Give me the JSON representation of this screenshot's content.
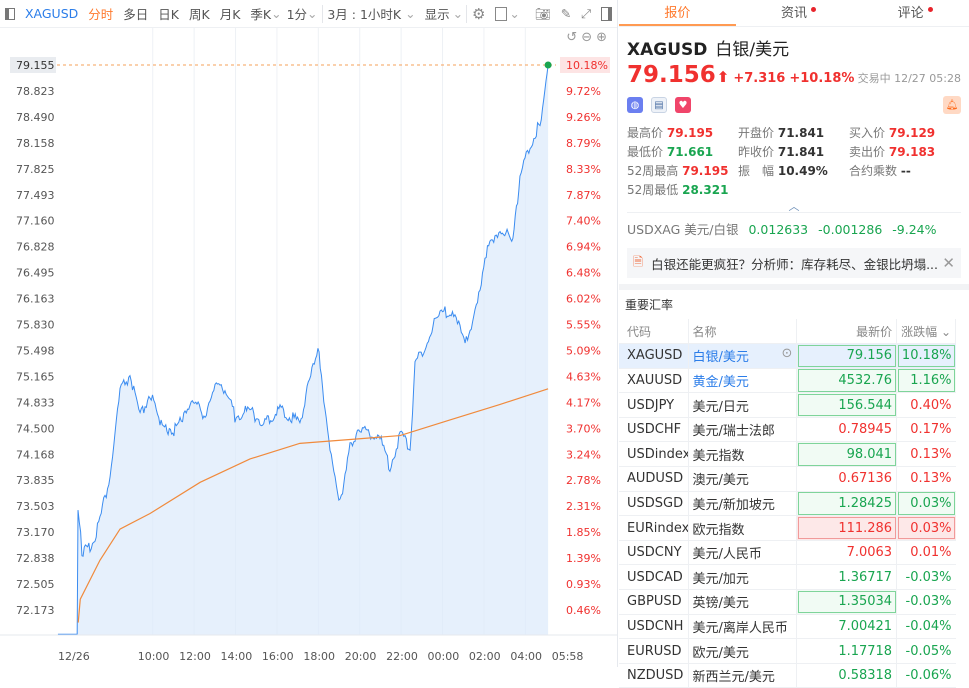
{
  "toolbar": {
    "symbol": "XAGUSD",
    "periods": [
      "分时",
      "多日",
      "日K",
      "周K",
      "月K",
      "季K"
    ],
    "interval": "1分",
    "range": "3月 : 1小时K",
    "display": "显示"
  },
  "chart_data": {
    "type": "line",
    "y_ticks": [
      "79.155",
      "78.823",
      "78.490",
      "78.158",
      "77.825",
      "77.493",
      "77.160",
      "76.828",
      "76.495",
      "76.163",
      "75.830",
      "75.498",
      "75.165",
      "74.833",
      "74.500",
      "74.168",
      "73.835",
      "73.503",
      "73.170",
      "72.838",
      "72.505",
      "72.173"
    ],
    "pct_ticks": [
      "10.18%",
      "9.72%",
      "9.26%",
      "8.79%",
      "8.33%",
      "7.87%",
      "7.40%",
      "6.94%",
      "6.48%",
      "6.02%",
      "5.55%",
      "5.09%",
      "4.63%",
      "4.17%",
      "3.70%",
      "3.24%",
      "2.78%",
      "2.31%",
      "1.85%",
      "1.39%",
      "0.93%",
      "0.46%"
    ],
    "x_ticks": [
      "12/26",
      "10:00",
      "12:00",
      "14:00",
      "16:00",
      "18:00",
      "20:00",
      "22:00",
      "00:00",
      "02:00",
      "04:00",
      "05:58"
    ],
    "x_tick_hours": [
      -0.5,
      3.9,
      5.9,
      7.9,
      9.9,
      11.9,
      13.9,
      15.9,
      17.9,
      19.9,
      21.9,
      23.9
    ],
    "ylim": [
      71.841,
      79.155
    ],
    "prev_close": 71.841,
    "last": 79.155,
    "price_series": [
      [
        -0.68,
        71.85
      ],
      [
        0.25,
        71.85
      ],
      [
        0.29,
        73.5
      ],
      [
        0.48,
        72.9
      ],
      [
        0.87,
        73.0
      ],
      [
        1.35,
        73.4
      ],
      [
        1.84,
        73.9
      ],
      [
        2.32,
        74.9
      ],
      [
        2.8,
        75.1
      ],
      [
        3.29,
        74.6
      ],
      [
        3.77,
        75.0
      ],
      [
        4.25,
        74.6
      ],
      [
        4.98,
        74.5
      ],
      [
        5.7,
        74.8
      ],
      [
        6.43,
        74.6
      ],
      [
        7.15,
        75.1
      ],
      [
        7.87,
        74.7
      ],
      [
        8.6,
        74.8
      ],
      [
        9.32,
        74.6
      ],
      [
        10.05,
        74.7
      ],
      [
        11.01,
        74.5
      ],
      [
        11.88,
        75.5
      ],
      [
        12.22,
        74.7
      ],
      [
        12.71,
        74.0
      ],
      [
        12.95,
        73.6
      ],
      [
        13.43,
        74.3
      ],
      [
        14.15,
        74.4
      ],
      [
        14.88,
        74.3
      ],
      [
        15.36,
        74.0
      ],
      [
        15.85,
        74.5
      ],
      [
        16.33,
        74.3
      ],
      [
        16.57,
        75.3
      ],
      [
        17.05,
        75.5
      ],
      [
        17.78,
        75.9
      ],
      [
        18.5,
        76.0
      ],
      [
        18.99,
        75.6
      ],
      [
        19.47,
        76.1
      ],
      [
        20.19,
        76.9
      ],
      [
        20.68,
        77.0
      ],
      [
        21.3,
        76.8
      ],
      [
        21.64,
        77.7
      ],
      [
        22.13,
        78.2
      ],
      [
        22.61,
        78.5
      ],
      [
        22.85,
        78.8
      ],
      [
        23.0,
        79.156
      ]
    ],
    "avg_series": [
      [
        0.3,
        72.0
      ],
      [
        0.4,
        72.3
      ],
      [
        1.35,
        72.8
      ],
      [
        2.32,
        73.2
      ],
      [
        3.77,
        73.4
      ],
      [
        6.19,
        73.8
      ],
      [
        8.6,
        74.1
      ],
      [
        11.01,
        74.3
      ],
      [
        13.43,
        74.35
      ],
      [
        15.85,
        74.4
      ],
      [
        18.26,
        74.6
      ],
      [
        20.68,
        74.8
      ],
      [
        23.0,
        75.0
      ]
    ],
    "colors": {
      "price": "#3b8cf0",
      "avg": "#f08a3c",
      "fill": "#dbe9fb"
    }
  },
  "right": {
    "tabs": [
      "报价",
      "资讯",
      "评论"
    ],
    "symbol": "XAGUSD",
    "name": "白银/美元",
    "price": "79.156",
    "arrow": "⬆",
    "change": "+7.316",
    "change_pct": "+10.18%",
    "status": "交易中 12/27 05:28",
    "stats": [
      [
        "最高价",
        "79.195",
        "r"
      ],
      [
        "开盘价",
        "71.841",
        "k"
      ],
      [
        "买入价",
        "79.129",
        "r"
      ],
      [
        "最低价",
        "71.661",
        "g"
      ],
      [
        "昨收价",
        "71.841",
        "k"
      ],
      [
        "卖出价",
        "79.183",
        "r"
      ],
      [
        "52周最高",
        "79.195",
        "r"
      ],
      [
        "振　幅",
        "10.49%",
        "k"
      ],
      [
        "合约乘数",
        "--",
        "k"
      ],
      [
        "52周最低",
        "28.321",
        "g"
      ]
    ],
    "inverse": {
      "label": "USDXAG 美元/白银",
      "price": "0.012633",
      "change": "-0.001286",
      "pct": "-9.24%"
    },
    "news": "白银还能更疯狂？分析师：库存耗尽、金银比坍塌...",
    "section": "重要汇率",
    "headers": [
      "代码",
      "名称",
      "最新价",
      "涨跌幅"
    ],
    "rows": [
      [
        "XAGUSD",
        "白银/美元",
        "79.156",
        "10.18%",
        "g",
        "g",
        "G",
        "G"
      ],
      [
        "XAUUSD",
        "黄金/美元",
        "4532.76",
        "1.16%",
        "g",
        "g",
        "G",
        "G"
      ],
      [
        "USDJPY",
        "美元/日元",
        "156.544",
        "0.40%",
        "g",
        "r",
        "G",
        ""
      ],
      [
        "USDCHF",
        "美元/瑞士法郎",
        "0.78945",
        "0.17%",
        "r",
        "r",
        "",
        ""
      ],
      [
        "USDindex",
        "美元指数",
        "98.041",
        "0.13%",
        "g",
        "r",
        "G",
        ""
      ],
      [
        "AUDUSD",
        "澳元/美元",
        "0.67136",
        "0.13%",
        "r",
        "r",
        "",
        ""
      ],
      [
        "USDSGD",
        "美元/新加坡元",
        "1.28425",
        "0.03%",
        "g",
        "g",
        "G",
        "G"
      ],
      [
        "EURindex",
        "欧元指数",
        "111.286",
        "0.03%",
        "r",
        "r",
        "R",
        "R"
      ],
      [
        "USDCNY",
        "美元/人民币",
        "7.0063",
        "0.01%",
        "r",
        "r",
        "",
        ""
      ],
      [
        "USDCAD",
        "美元/加元",
        "1.36717",
        "-0.03%",
        "g",
        "g",
        "",
        ""
      ],
      [
        "GBPUSD",
        "英镑/美元",
        "1.35034",
        "-0.03%",
        "g",
        "g",
        "G",
        ""
      ],
      [
        "USDCNH",
        "美元/离岸人民币",
        "7.00421",
        "-0.04%",
        "g",
        "g",
        "",
        ""
      ],
      [
        "EURUSD",
        "欧元/美元",
        "1.17718",
        "-0.05%",
        "g",
        "g",
        "",
        ""
      ],
      [
        "NZDUSD",
        "新西兰元/美元",
        "0.58318",
        "-0.06%",
        "g",
        "g",
        "",
        ""
      ]
    ]
  }
}
